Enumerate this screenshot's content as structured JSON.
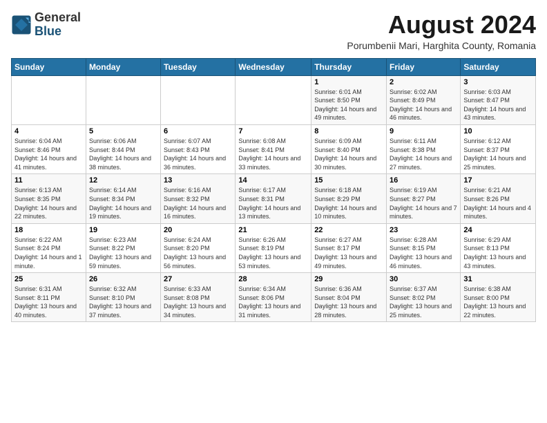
{
  "logo": {
    "text_general": "General",
    "text_blue": "Blue"
  },
  "title": "August 2024",
  "subtitle": "Porumbenii Mari, Harghita County, Romania",
  "days_of_week": [
    "Sunday",
    "Monday",
    "Tuesday",
    "Wednesday",
    "Thursday",
    "Friday",
    "Saturday"
  ],
  "weeks": [
    [
      {
        "day": "",
        "sunrise": "",
        "sunset": "",
        "daylight": ""
      },
      {
        "day": "",
        "sunrise": "",
        "sunset": "",
        "daylight": ""
      },
      {
        "day": "",
        "sunrise": "",
        "sunset": "",
        "daylight": ""
      },
      {
        "day": "",
        "sunrise": "",
        "sunset": "",
        "daylight": ""
      },
      {
        "day": "1",
        "sunrise": "6:01 AM",
        "sunset": "8:50 PM",
        "daylight": "14 hours and 49 minutes."
      },
      {
        "day": "2",
        "sunrise": "6:02 AM",
        "sunset": "8:49 PM",
        "daylight": "14 hours and 46 minutes."
      },
      {
        "day": "3",
        "sunrise": "6:03 AM",
        "sunset": "8:47 PM",
        "daylight": "14 hours and 43 minutes."
      }
    ],
    [
      {
        "day": "4",
        "sunrise": "6:04 AM",
        "sunset": "8:46 PM",
        "daylight": "14 hours and 41 minutes."
      },
      {
        "day": "5",
        "sunrise": "6:06 AM",
        "sunset": "8:44 PM",
        "daylight": "14 hours and 38 minutes."
      },
      {
        "day": "6",
        "sunrise": "6:07 AM",
        "sunset": "8:43 PM",
        "daylight": "14 hours and 36 minutes."
      },
      {
        "day": "7",
        "sunrise": "6:08 AM",
        "sunset": "8:41 PM",
        "daylight": "14 hours and 33 minutes."
      },
      {
        "day": "8",
        "sunrise": "6:09 AM",
        "sunset": "8:40 PM",
        "daylight": "14 hours and 30 minutes."
      },
      {
        "day": "9",
        "sunrise": "6:11 AM",
        "sunset": "8:38 PM",
        "daylight": "14 hours and 27 minutes."
      },
      {
        "day": "10",
        "sunrise": "6:12 AM",
        "sunset": "8:37 PM",
        "daylight": "14 hours and 25 minutes."
      }
    ],
    [
      {
        "day": "11",
        "sunrise": "6:13 AM",
        "sunset": "8:35 PM",
        "daylight": "14 hours and 22 minutes."
      },
      {
        "day": "12",
        "sunrise": "6:14 AM",
        "sunset": "8:34 PM",
        "daylight": "14 hours and 19 minutes."
      },
      {
        "day": "13",
        "sunrise": "6:16 AM",
        "sunset": "8:32 PM",
        "daylight": "14 hours and 16 minutes."
      },
      {
        "day": "14",
        "sunrise": "6:17 AM",
        "sunset": "8:31 PM",
        "daylight": "14 hours and 13 minutes."
      },
      {
        "day": "15",
        "sunrise": "6:18 AM",
        "sunset": "8:29 PM",
        "daylight": "14 hours and 10 minutes."
      },
      {
        "day": "16",
        "sunrise": "6:19 AM",
        "sunset": "8:27 PM",
        "daylight": "14 hours and 7 minutes."
      },
      {
        "day": "17",
        "sunrise": "6:21 AM",
        "sunset": "8:26 PM",
        "daylight": "14 hours and 4 minutes."
      }
    ],
    [
      {
        "day": "18",
        "sunrise": "6:22 AM",
        "sunset": "8:24 PM",
        "daylight": "14 hours and 1 minute."
      },
      {
        "day": "19",
        "sunrise": "6:23 AM",
        "sunset": "8:22 PM",
        "daylight": "13 hours and 59 minutes."
      },
      {
        "day": "20",
        "sunrise": "6:24 AM",
        "sunset": "8:20 PM",
        "daylight": "13 hours and 56 minutes."
      },
      {
        "day": "21",
        "sunrise": "6:26 AM",
        "sunset": "8:19 PM",
        "daylight": "13 hours and 53 minutes."
      },
      {
        "day": "22",
        "sunrise": "6:27 AM",
        "sunset": "8:17 PM",
        "daylight": "13 hours and 49 minutes."
      },
      {
        "day": "23",
        "sunrise": "6:28 AM",
        "sunset": "8:15 PM",
        "daylight": "13 hours and 46 minutes."
      },
      {
        "day": "24",
        "sunrise": "6:29 AM",
        "sunset": "8:13 PM",
        "daylight": "13 hours and 43 minutes."
      }
    ],
    [
      {
        "day": "25",
        "sunrise": "6:31 AM",
        "sunset": "8:11 PM",
        "daylight": "13 hours and 40 minutes."
      },
      {
        "day": "26",
        "sunrise": "6:32 AM",
        "sunset": "8:10 PM",
        "daylight": "13 hours and 37 minutes."
      },
      {
        "day": "27",
        "sunrise": "6:33 AM",
        "sunset": "8:08 PM",
        "daylight": "13 hours and 34 minutes."
      },
      {
        "day": "28",
        "sunrise": "6:34 AM",
        "sunset": "8:06 PM",
        "daylight": "13 hours and 31 minutes."
      },
      {
        "day": "29",
        "sunrise": "6:36 AM",
        "sunset": "8:04 PM",
        "daylight": "13 hours and 28 minutes."
      },
      {
        "day": "30",
        "sunrise": "6:37 AM",
        "sunset": "8:02 PM",
        "daylight": "13 hours and 25 minutes."
      },
      {
        "day": "31",
        "sunrise": "6:38 AM",
        "sunset": "8:00 PM",
        "daylight": "13 hours and 22 minutes."
      }
    ]
  ],
  "labels": {
    "sunrise": "Sunrise:",
    "sunset": "Sunset:",
    "daylight": "Daylight:"
  }
}
